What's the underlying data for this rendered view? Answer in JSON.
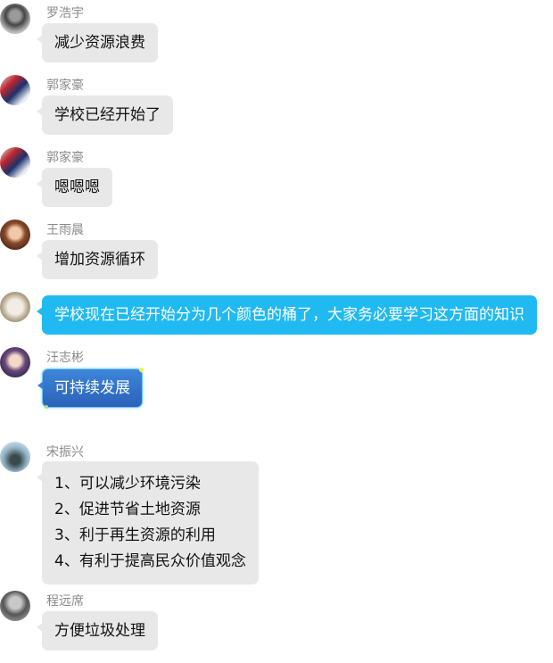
{
  "messages": [
    {
      "sender": "罗浩宇",
      "text": "减少资源浪费"
    },
    {
      "sender": "郭家豪",
      "text": "学校已经开始了"
    },
    {
      "sender": "郭家豪",
      "text": "嗯嗯嗯"
    },
    {
      "sender": "王雨晨",
      "text": "增加资源循环"
    },
    {
      "sender": "",
      "text": "学校现在已经开始分为几个颜色的桶了，大家务必要学习这方面的知识"
    },
    {
      "sender": "汪志彬",
      "text": "可持续发展"
    },
    {
      "sender": "宋振兴",
      "lines": [
        "1、可以减少环境污染",
        "2、促进节省土地资源",
        "3、利于再生资源的利用",
        "4、有利于提高民众价值观念"
      ]
    },
    {
      "sender": "程远席",
      "text": "方便垃圾处理"
    }
  ],
  "colors": {
    "bubble_default": "#e8e8e8",
    "bubble_highlight": "#20b9f2",
    "bubble_special": "#3e86d9",
    "sender_name": "#8a8a8a"
  }
}
